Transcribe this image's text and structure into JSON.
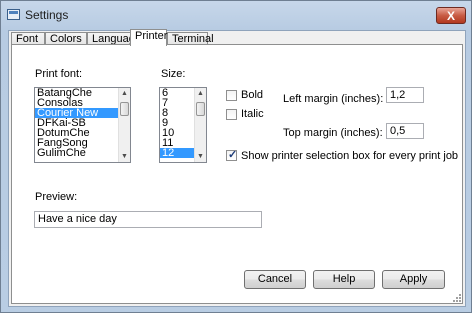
{
  "window": {
    "title": "Settings",
    "close_label": "X"
  },
  "tabs": [
    {
      "label": "Font"
    },
    {
      "label": "Colors"
    },
    {
      "label": "Language"
    },
    {
      "label": "Printer",
      "active": true
    },
    {
      "label": "Terminal"
    }
  ],
  "printer": {
    "print_font_label": "Print font:",
    "fonts": [
      "BatangChe",
      "Consolas",
      "Courier New",
      "DFKai-SB",
      "DotumChe",
      "FangSong",
      "GulimChe"
    ],
    "selected_font": "Courier New",
    "size_label": "Size:",
    "sizes": [
      "6",
      "7",
      "8",
      "9",
      "10",
      "11",
      "12"
    ],
    "selected_size": "12",
    "bold_label": "Bold",
    "bold_checked": false,
    "italic_label": "Italic",
    "italic_checked": false,
    "left_margin_label": "Left margin (inches):",
    "left_margin_value": "1,2",
    "top_margin_label": "Top margin (inches):",
    "top_margin_value": "0,5",
    "show_selection_label": "Show printer selection box for every print job",
    "show_selection_checked": true,
    "preview_label": "Preview:",
    "preview_text": "Have a nice day"
  },
  "buttons": {
    "cancel": "Cancel",
    "help": "Help",
    "apply": "Apply"
  }
}
